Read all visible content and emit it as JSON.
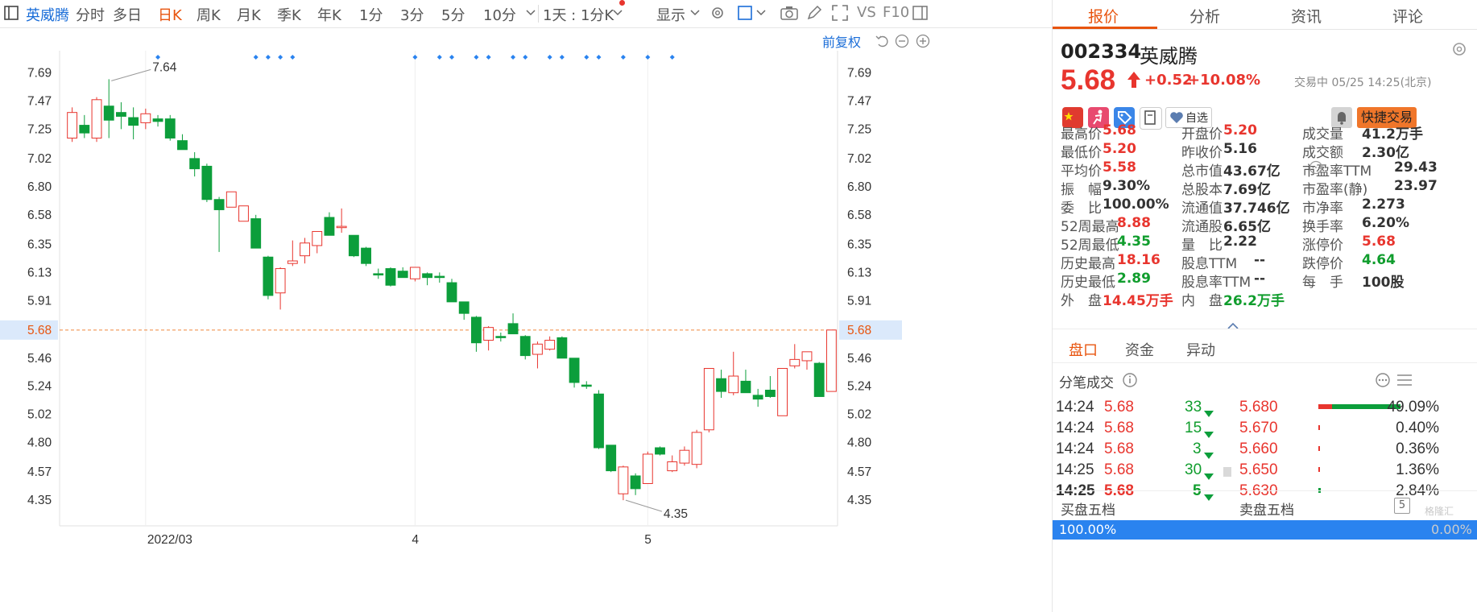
{
  "toolbar": {
    "stock_name": "英威腾",
    "periods": [
      "分时",
      "多日",
      "日K",
      "周K",
      "月K",
      "季K",
      "年K",
      "1分",
      "3分",
      "5分",
      "10分"
    ],
    "active_period": "日K",
    "interval_select": "1天 : 1分K",
    "display_label": "显示",
    "vs_label": "VS",
    "f10_label": "F10"
  },
  "chart": {
    "adjust_label": "前复权",
    "high_annotation": "7.64",
    "low_annotation": "4.35",
    "y_ticks": [
      "7.69",
      "7.47",
      "7.25",
      "7.02",
      "6.80",
      "6.58",
      "6.35",
      "6.13",
      "5.91",
      "5.68",
      "5.46",
      "5.24",
      "5.02",
      "4.80",
      "4.57",
      "4.35"
    ],
    "current_price_label": "5.68",
    "x_labels": [
      "2022/03",
      "4",
      "5"
    ]
  },
  "chart_data": {
    "type": "candlestick",
    "y_range": [
      4.2,
      7.85
    ],
    "current_price": 5.68,
    "up_color": "#e8352e",
    "down_color": "#0c9e3b",
    "candles": [
      {
        "o": 7.18,
        "h": 7.42,
        "l": 7.15,
        "c": 7.38
      },
      {
        "o": 7.28,
        "h": 7.36,
        "l": 7.18,
        "c": 7.22
      },
      {
        "o": 7.18,
        "h": 7.5,
        "l": 7.15,
        "c": 7.48
      },
      {
        "o": 7.43,
        "h": 7.64,
        "l": 7.18,
        "c": 7.32
      },
      {
        "o": 7.38,
        "h": 7.46,
        "l": 7.25,
        "c": 7.35
      },
      {
        "o": 7.34,
        "h": 7.42,
        "l": 7.17,
        "c": 7.28
      },
      {
        "o": 7.3,
        "h": 7.41,
        "l": 7.25,
        "c": 7.37
      },
      {
        "o": 7.33,
        "h": 7.36,
        "l": 7.27,
        "c": 7.31
      },
      {
        "o": 7.33,
        "h": 7.36,
        "l": 7.16,
        "c": 7.18
      },
      {
        "o": 7.16,
        "h": 7.21,
        "l": 7.09,
        "c": 7.09
      },
      {
        "o": 7.02,
        "h": 7.07,
        "l": 6.88,
        "c": 6.94
      },
      {
        "o": 6.96,
        "h": 6.98,
        "l": 6.68,
        "c": 6.7
      },
      {
        "o": 6.7,
        "h": 6.72,
        "l": 6.29,
        "c": 6.62
      },
      {
        "o": 6.64,
        "h": 6.76,
        "l": 6.64,
        "c": 6.76
      },
      {
        "o": 6.53,
        "h": 6.65,
        "l": 6.53,
        "c": 6.65
      },
      {
        "o": 6.55,
        "h": 6.58,
        "l": 6.32,
        "c": 6.32
      },
      {
        "o": 6.25,
        "h": 6.26,
        "l": 5.92,
        "c": 5.95
      },
      {
        "o": 5.97,
        "h": 6.17,
        "l": 5.84,
        "c": 6.16
      },
      {
        "o": 6.2,
        "h": 6.38,
        "l": 6.18,
        "c": 6.22
      },
      {
        "o": 6.26,
        "h": 6.4,
        "l": 6.2,
        "c": 6.36
      },
      {
        "o": 6.34,
        "h": 6.44,
        "l": 6.28,
        "c": 6.45
      },
      {
        "o": 6.56,
        "h": 6.6,
        "l": 6.42,
        "c": 6.42
      },
      {
        "o": 6.48,
        "h": 6.63,
        "l": 6.44,
        "c": 6.49
      },
      {
        "o": 6.42,
        "h": 6.42,
        "l": 6.25,
        "c": 6.26
      },
      {
        "o": 6.32,
        "h": 6.33,
        "l": 6.18,
        "c": 6.2
      },
      {
        "o": 6.12,
        "h": 6.16,
        "l": 6.08,
        "c": 6.11
      },
      {
        "o": 6.16,
        "h": 6.17,
        "l": 6.02,
        "c": 6.03
      },
      {
        "o": 6.14,
        "h": 6.17,
        "l": 6.09,
        "c": 6.09
      },
      {
        "o": 6.08,
        "h": 6.17,
        "l": 6.06,
        "c": 6.17
      },
      {
        "o": 6.12,
        "h": 6.13,
        "l": 6.03,
        "c": 6.09
      },
      {
        "o": 6.1,
        "h": 6.13,
        "l": 6.05,
        "c": 6.09
      },
      {
        "o": 6.05,
        "h": 6.08,
        "l": 5.9,
        "c": 5.9
      },
      {
        "o": 5.9,
        "h": 5.9,
        "l": 5.76,
        "c": 5.81
      },
      {
        "o": 5.78,
        "h": 5.79,
        "l": 5.51,
        "c": 5.58
      },
      {
        "o": 5.6,
        "h": 5.71,
        "l": 5.52,
        "c": 5.7
      },
      {
        "o": 5.63,
        "h": 5.66,
        "l": 5.59,
        "c": 5.62
      },
      {
        "o": 5.73,
        "h": 5.81,
        "l": 5.65,
        "c": 5.65
      },
      {
        "o": 5.63,
        "h": 5.64,
        "l": 5.45,
        "c": 5.48
      },
      {
        "o": 5.49,
        "h": 5.59,
        "l": 5.38,
        "c": 5.57
      },
      {
        "o": 5.53,
        "h": 5.63,
        "l": 5.52,
        "c": 5.6
      },
      {
        "o": 5.62,
        "h": 5.63,
        "l": 5.46,
        "c": 5.46
      },
      {
        "o": 5.46,
        "h": 5.46,
        "l": 5.23,
        "c": 5.27
      },
      {
        "o": 5.25,
        "h": 5.28,
        "l": 5.22,
        "c": 5.24
      },
      {
        "o": 5.18,
        "h": 5.21,
        "l": 4.75,
        "c": 4.76
      },
      {
        "o": 4.78,
        "h": 4.78,
        "l": 4.57,
        "c": 4.58
      },
      {
        "o": 4.4,
        "h": 4.62,
        "l": 4.35,
        "c": 4.61
      },
      {
        "o": 4.54,
        "h": 4.56,
        "l": 4.39,
        "c": 4.44
      },
      {
        "o": 4.48,
        "h": 4.73,
        "l": 4.48,
        "c": 4.71
      },
      {
        "o": 4.76,
        "h": 4.77,
        "l": 4.7,
        "c": 4.71
      },
      {
        "o": 4.58,
        "h": 4.7,
        "l": 4.57,
        "c": 4.65
      },
      {
        "o": 4.64,
        "h": 4.77,
        "l": 4.62,
        "c": 4.74
      },
      {
        "o": 4.63,
        "h": 4.9,
        "l": 4.6,
        "c": 4.88
      },
      {
        "o": 4.9,
        "h": 5.38,
        "l": 4.88,
        "c": 5.38
      },
      {
        "o": 5.3,
        "h": 5.37,
        "l": 5.15,
        "c": 5.2
      },
      {
        "o": 5.19,
        "h": 5.51,
        "l": 5.17,
        "c": 5.32
      },
      {
        "o": 5.28,
        "h": 5.37,
        "l": 5.19,
        "c": 5.19
      },
      {
        "o": 5.17,
        "h": 5.22,
        "l": 5.08,
        "c": 5.14
      },
      {
        "o": 5.21,
        "h": 5.32,
        "l": 5.15,
        "c": 5.16
      },
      {
        "o": 5.01,
        "h": 5.38,
        "l": 5.01,
        "c": 5.38
      },
      {
        "o": 5.4,
        "h": 5.57,
        "l": 5.38,
        "c": 5.45
      },
      {
        "o": 5.44,
        "h": 5.5,
        "l": 5.37,
        "c": 5.51
      },
      {
        "o": 5.42,
        "h": 5.43,
        "l": 5.16,
        "c": 5.16
      },
      {
        "o": 5.2,
        "h": 5.68,
        "l": 5.2,
        "c": 5.68
      }
    ]
  },
  "panel": {
    "tabs": [
      "报价",
      "分析",
      "资讯",
      "评论"
    ],
    "active_tab": "报价",
    "code": "002334",
    "name": "英威腾",
    "price": "5.68",
    "change": "+0.52",
    "change_pct": "+10.08%",
    "status_time": "交易中 05/25 14:25(北京)",
    "watchlist_label": "自选",
    "quick_trade_label": "快捷交易",
    "quote_rows": [
      [
        {
          "label": "最高价",
          "value": "5.68",
          "color": "red"
        },
        {
          "label": "开盘价",
          "value": "5.20",
          "color": "red"
        },
        {
          "label": "成交量",
          "value": "41.2万手",
          "color": "dark"
        }
      ],
      [
        {
          "label": "最低价",
          "value": "5.20",
          "color": "red"
        },
        {
          "label": "昨收价",
          "value": "5.16",
          "color": "dark"
        },
        {
          "label": "成交额",
          "value": "2.30亿",
          "color": "dark"
        }
      ],
      [
        {
          "label": "平均价",
          "value": "5.58",
          "color": "red"
        },
        {
          "label": "总市值",
          "value": "43.67亿",
          "color": "dark"
        },
        {
          "label": "市盈率TTM",
          "value": "29.43",
          "color": "dark"
        }
      ],
      [
        {
          "label": "振　幅",
          "value": "9.30%",
          "color": "dark"
        },
        {
          "label": "总股本",
          "value": "7.69亿",
          "color": "dark"
        },
        {
          "label": "市盈率(静)",
          "value": "23.97",
          "color": "dark"
        }
      ],
      [
        {
          "label": "委　比",
          "value": "100.00%",
          "color": "dark"
        },
        {
          "label": "流通值",
          "value": "37.746亿",
          "color": "dark"
        },
        {
          "label": "市净率",
          "value": "2.273",
          "color": "dark"
        }
      ],
      [
        {
          "label": "52周最高",
          "value": "8.88",
          "color": "red"
        },
        {
          "label": "流通股",
          "value": "6.65亿",
          "color": "dark"
        },
        {
          "label": "换手率",
          "value": "6.20%",
          "color": "dark"
        }
      ],
      [
        {
          "label": "52周最低",
          "value": "4.35",
          "color": "green"
        },
        {
          "label": "量　比",
          "value": "2.22",
          "color": "dark"
        },
        {
          "label": "涨停价",
          "value": "5.68",
          "color": "red"
        }
      ],
      [
        {
          "label": "历史最高",
          "value": "18.16",
          "color": "red"
        },
        {
          "label": "股息TTM",
          "value": "--",
          "color": "dark"
        },
        {
          "label": "跌停价",
          "value": "4.64",
          "color": "green"
        }
      ],
      [
        {
          "label": "历史最低",
          "value": "2.89",
          "color": "green"
        },
        {
          "label": "股息率TTM",
          "value": "--",
          "color": "dark"
        },
        {
          "label": "每　手",
          "value": "100股",
          "color": "dark"
        }
      ],
      [
        {
          "label": "外　盘",
          "value": "14.45万手",
          "color": "red"
        },
        {
          "label": "内　盘",
          "value": "26.2万手",
          "color": "green"
        }
      ]
    ],
    "sub_tabs": [
      "盘口",
      "资金",
      "异动"
    ],
    "active_sub_tab": "盘口",
    "trades_title": "分笔成交",
    "trades": [
      {
        "time": "14:24",
        "price": "5.68",
        "vol": "33",
        "bold": false
      },
      {
        "time": "14:24",
        "price": "5.68",
        "vol": "15",
        "bold": false
      },
      {
        "time": "14:24",
        "price": "5.68",
        "vol": "3",
        "bold": false
      },
      {
        "time": "14:25",
        "price": "5.68",
        "vol": "30",
        "bold": false
      },
      {
        "time": "14:25",
        "price": "5.68",
        "vol": "5",
        "bold": true
      }
    ],
    "dist": [
      {
        "price": "5.680",
        "pct": "49.09%",
        "buy_share": 0.49,
        "total": 0.98
      },
      {
        "price": "5.670",
        "pct": "0.40%",
        "buy_share": 0.004,
        "total": 0.004
      },
      {
        "price": "5.660",
        "pct": "0.36%",
        "buy_share": 0.0036,
        "total": 0.0036
      },
      {
        "price": "5.650",
        "pct": "1.36%",
        "buy_share": 0.0136,
        "total": 0.0136
      },
      {
        "price": "5.630",
        "pct": "2.84%",
        "buy_share": 0.0284,
        "total": 0.0284
      }
    ],
    "buy_five_label": "买盘五档",
    "sell_five_label": "卖盘五档",
    "buy_ratio": "100.00%",
    "sell_ratio": "0.00%",
    "buy_ratio_value": 1.0,
    "watermark": "格隆汇"
  }
}
